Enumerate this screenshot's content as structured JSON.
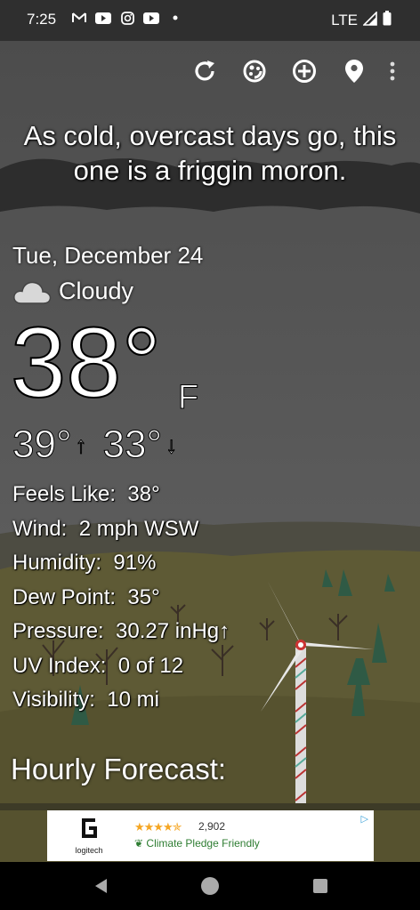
{
  "status_bar": {
    "time": "7:25",
    "network": "LTE",
    "left_icons": [
      "gmail-icon",
      "youtube-icon",
      "instagram-icon",
      "youtube-icon",
      "dot-icon"
    ]
  },
  "toolbar": {
    "icons": [
      "refresh-icon",
      "theme-icon",
      "add-location-icon",
      "location-pin-icon",
      "more-vert-icon"
    ]
  },
  "headline": "As cold, overcast days go, this one is a friggin moron.",
  "weather": {
    "date": "Tue, December 24",
    "condition": "Cloudy",
    "temperature": "38°",
    "unit": "F",
    "high": "39°",
    "low": "33°",
    "details": [
      {
        "label": "Feels Like:",
        "value": "38°"
      },
      {
        "label": "Wind:",
        "value": "2 mph WSW"
      },
      {
        "label": "Humidity:",
        "value": "91%"
      },
      {
        "label": "Dew Point:",
        "value": "35°"
      },
      {
        "label": "Pressure:",
        "value": "30.27 inHg↑"
      },
      {
        "label": "UV Index:",
        "value": "0 of 12"
      },
      {
        "label": "Visibility:",
        "value": "10 mi"
      }
    ]
  },
  "hourly_title": "Hourly Forecast:",
  "ad": {
    "brand": "logitech",
    "rating_count": "2,902",
    "pledge": "Climate Pledge Friendly",
    "stars": "★★★★✯"
  },
  "colors": {
    "sky": "#5a5a5a",
    "cloud": "#2b2b2b",
    "hill": "#4a4a30",
    "grass": "#5f5a34"
  }
}
